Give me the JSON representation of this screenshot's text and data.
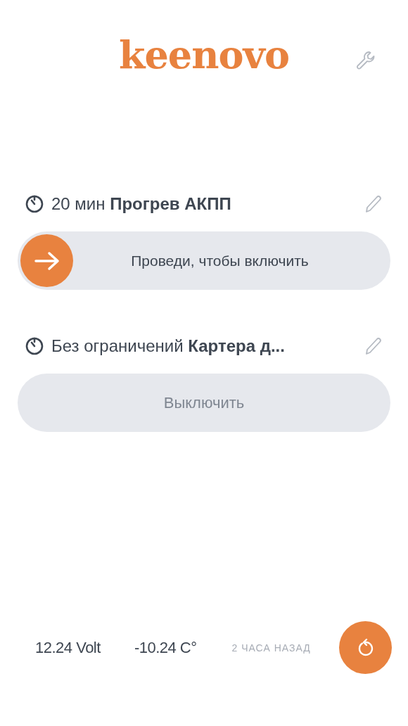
{
  "header": {
    "logo": "keenovo"
  },
  "programs": [
    {
      "title": "20 мин **Прогрев АКПП**",
      "kind": "swipe",
      "action": "Проведи, чтобы включить",
      "disabled": false
    },
    {
      "title": "Без ограничений **Картера д...**",
      "kind": "button",
      "action": "Выключить",
      "disabled": true
    }
  ],
  "status_bar": {
    "voltage": "12.24 Volt",
    "temperature": "-10.24 C°",
    "updated": "2 ЧАСА НАЗАД"
  }
}
